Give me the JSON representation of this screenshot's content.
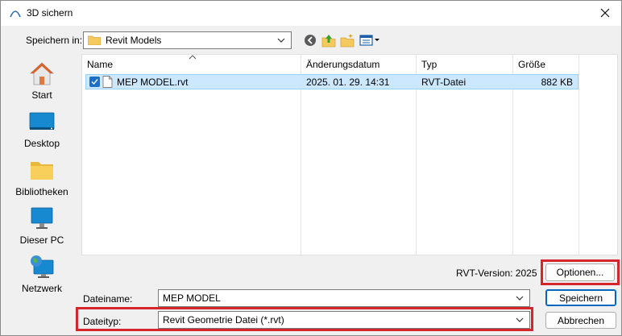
{
  "window": {
    "title": "3D sichern",
    "close_icon": "close-icon"
  },
  "savein": {
    "label": "Speichern in:",
    "folder": "Revit Models"
  },
  "toolbar": {
    "icons": [
      "back-icon",
      "up-folder-icon",
      "new-folder-icon",
      "view-menu-icon"
    ]
  },
  "places": [
    {
      "label": "Start",
      "icon": "home-icon"
    },
    {
      "label": "Desktop",
      "icon": "desktop-icon"
    },
    {
      "label": "Bibliotheken",
      "icon": "library-folder-icon"
    },
    {
      "label": "Dieser PC",
      "icon": "computer-icon"
    },
    {
      "label": "Netzwerk",
      "icon": "network-icon"
    }
  ],
  "columns": {
    "name": "Name",
    "date": "Änderungsdatum",
    "type": "Typ",
    "size": "Größe"
  },
  "files": [
    {
      "name": "MEP MODEL.rvt",
      "date": "2025. 01. 29. 14:31",
      "type": "RVT-Datei",
      "size": "882 KB",
      "selected": true
    }
  ],
  "rvt_version": "RVT-Version: 2025",
  "buttons": {
    "options": "Optionen...",
    "save": "Speichern",
    "cancel": "Abbrechen"
  },
  "filename": {
    "label": "Dateiname:",
    "value": "MEP MODEL"
  },
  "filetype": {
    "label": "Dateityp:",
    "value": "Revit Geometrie Datei (*.rvt)"
  },
  "colors": {
    "highlight_red": "#d6262b",
    "selection_bg": "#cce8ff",
    "accent_blue": "#0067c0"
  }
}
